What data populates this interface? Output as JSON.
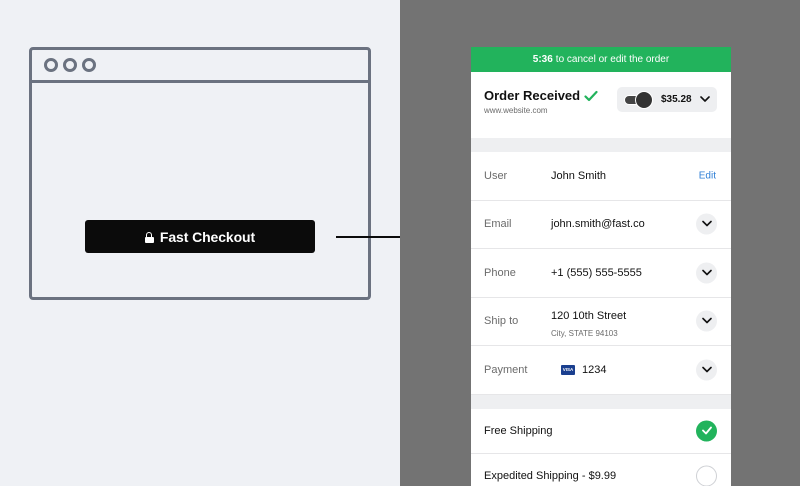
{
  "left": {
    "button_label": "Fast Checkout"
  },
  "panel": {
    "timer": {
      "time": "5:36",
      "text": "to cancel or edit the order"
    },
    "order": {
      "title": "Order Received",
      "site": "www.website.com",
      "price": "$35.28"
    },
    "rows": [
      {
        "label": "User",
        "value": "John Smith",
        "action": "Edit"
      },
      {
        "label": "Email",
        "value": "john.smith@fast.co"
      },
      {
        "label": "Phone",
        "value": "+1 (555) 555-5555"
      },
      {
        "label": "Ship to",
        "value": "120 10th Street",
        "sub": "City, STATE 94103"
      },
      {
        "label": "Payment",
        "card_brand": "VISA",
        "value": "1234"
      }
    ],
    "shipping": [
      {
        "label": "Free Shipping",
        "selected": true
      },
      {
        "label": "Expedited Shipping - $9.99",
        "selected": false
      }
    ]
  },
  "colors": {
    "accent": "#22b35c",
    "link": "#2f7fd6",
    "dark_bg": "#737373",
    "light_bg": "#eff1f5"
  },
  "icons": [
    "lock-icon",
    "arrow-right-icon",
    "check-icon",
    "chevron-down-icon",
    "visa-card-icon"
  ]
}
